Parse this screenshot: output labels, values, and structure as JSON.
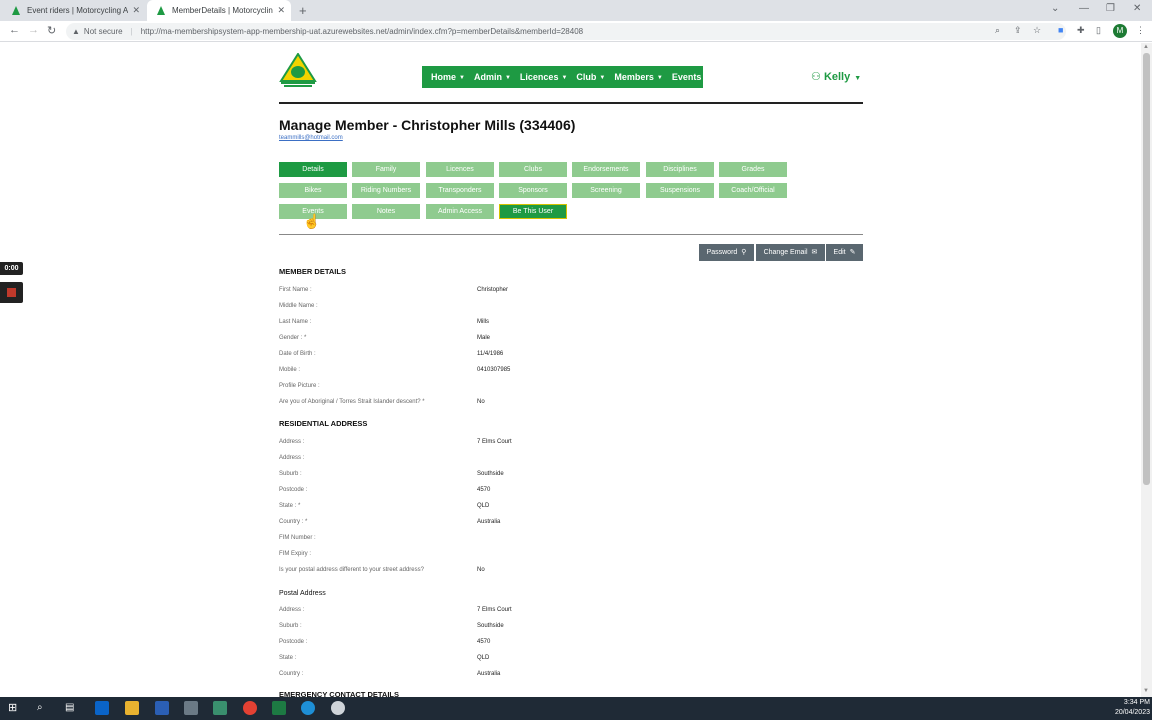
{
  "browser": {
    "tabs": [
      {
        "title": "Event riders | Motorcycling Austr",
        "active": false
      },
      {
        "title": "MemberDetails | Motorcycling A",
        "active": true
      }
    ],
    "security_label": "Not secure",
    "url": "http://ma-membershipsystem-app-membership-uat.azurewebsites.net/admin/index.cfm?p=memberDetails&memberId=28408",
    "profile_initial": "M"
  },
  "recorder": {
    "time": "0:00"
  },
  "header": {
    "logo_alt": "Motorcycling Australia",
    "nav": [
      {
        "label": "Home"
      },
      {
        "label": "Admin"
      },
      {
        "label": "Licences"
      },
      {
        "label": "Club"
      },
      {
        "label": "Members"
      },
      {
        "label": "Events"
      }
    ],
    "user": "Kelly"
  },
  "page": {
    "title": "Manage Member - Christopher Mills (334406)",
    "email": "teammills@hotmail.com"
  },
  "tabs_row1": [
    "Details",
    "Family",
    "Licences",
    "Clubs",
    "Endorsements",
    "Disciplines",
    "Grades"
  ],
  "tabs_row2": [
    "Bikes",
    "Riding Numbers",
    "Transponders",
    "Sponsors",
    "Screening",
    "Suspensions",
    "Coach/Official"
  ],
  "tabs_row3": [
    "Events",
    "Notes",
    "Admin Access",
    "Be This User"
  ],
  "actions": {
    "password": "Password",
    "change_email": "Change Email",
    "edit": "Edit"
  },
  "member_details": {
    "heading": "MEMBER DETAILS",
    "rows": [
      {
        "label": "First Name :",
        "value": "Christopher"
      },
      {
        "label": "Middle Name :",
        "value": ""
      },
      {
        "label": "Last Name :",
        "value": "Mills"
      },
      {
        "label": "Gender : *",
        "value": "Male"
      },
      {
        "label": "Date of Birth :",
        "value": "11/4/1986"
      },
      {
        "label": "Mobile :",
        "value": "0410307985"
      },
      {
        "label": "Profile Picture :",
        "value": ""
      },
      {
        "label": "Are you of Aboriginal / Torres Strait Islander descent? *",
        "value": "No"
      }
    ]
  },
  "residential_address": {
    "heading": "RESIDENTIAL ADDRESS",
    "rows": [
      {
        "label": "Address :",
        "value": "7 Elms Court"
      },
      {
        "label": "Address :",
        "value": ""
      },
      {
        "label": "Suburb :",
        "value": "Southside"
      },
      {
        "label": "Postcode :",
        "value": "4570"
      },
      {
        "label": "State : *",
        "value": "QLD"
      },
      {
        "label": "Country : *",
        "value": "Australia"
      },
      {
        "label": "FIM Number :",
        "value": ""
      },
      {
        "label": "FIM Expiry :",
        "value": ""
      },
      {
        "label": "Is your postal address different to your street address?",
        "value": "No"
      }
    ]
  },
  "postal_address": {
    "heading": "Postal Address",
    "rows": [
      {
        "label": "Address :",
        "value": "7 Elms Court"
      },
      {
        "label": "Suburb :",
        "value": "Southside"
      },
      {
        "label": "Postcode :",
        "value": "4570"
      },
      {
        "label": "State :",
        "value": "QLD"
      },
      {
        "label": "Country :",
        "value": "Australia"
      }
    ]
  },
  "emergency_contact": {
    "heading": "EMERGENCY CONTACT DETAILS"
  },
  "taskbar": {
    "time": "3:34 PM",
    "date": "20/04/2023"
  },
  "colors": {
    "brand_green": "#1e9a43",
    "light_green": "#8fcb8f",
    "action_gray": "#5a6770"
  }
}
